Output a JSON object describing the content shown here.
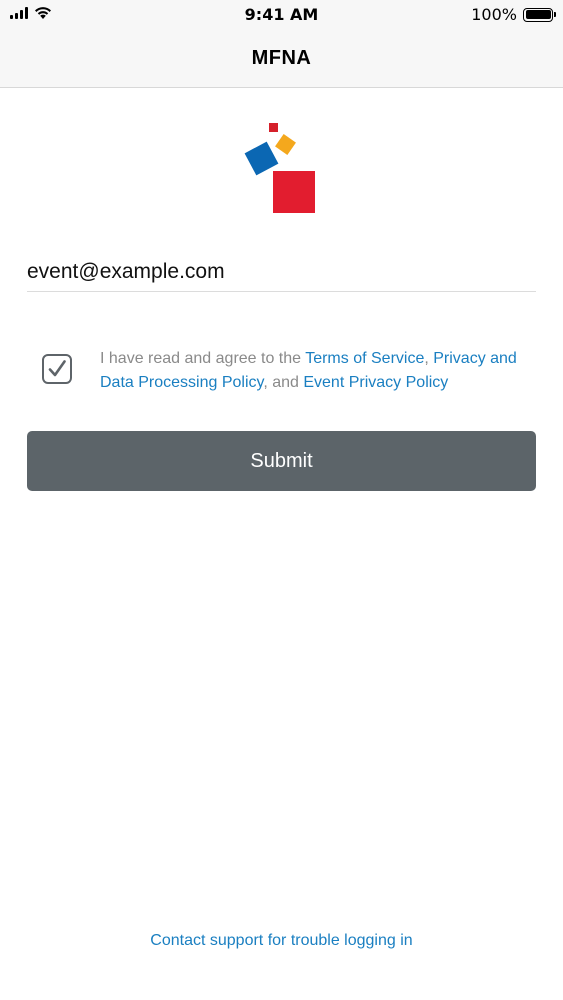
{
  "status_bar": {
    "time": "9:41 AM",
    "battery_percent": "100%",
    "icons": [
      "signal-icon",
      "wifi-icon",
      "battery-icon"
    ]
  },
  "nav": {
    "title": "MFNA"
  },
  "logo": {
    "icon": "squares-logo-icon",
    "colors": {
      "red": "#e21d2f",
      "blue": "#0b67b3",
      "orange": "#f4a81d",
      "small_red": "#d5202b"
    }
  },
  "login": {
    "email_value": "event@example.com"
  },
  "consent": {
    "checked": true,
    "prefix": "I have read and agree to the ",
    "terms_link": "Terms of Service",
    "sep1": ", ",
    "privacy_link": "Privacy and Data Processing Policy",
    "sep2": ", and ",
    "event_privacy_link": "Event Privacy Policy"
  },
  "submit": {
    "label": "Submit"
  },
  "support": {
    "label": "Contact support for trouble logging in"
  },
  "colors": {
    "link": "#1a7fc1",
    "button": "#5c6469",
    "muted_text": "#8a8a8a"
  }
}
